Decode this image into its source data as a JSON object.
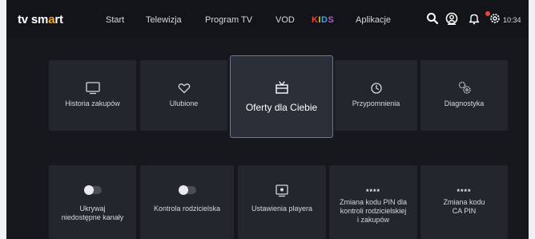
{
  "header": {
    "logo_prefix": "tv sm",
    "logo_mark": "a",
    "logo_suffix": "rt",
    "nav": {
      "start": "Start",
      "telewizja": "Telewizja",
      "program": "Program TV",
      "vod": "VOD",
      "kids_letters": [
        "K",
        "I",
        "D",
        "S"
      ],
      "aplikacje": "Aplikacje"
    },
    "icons": [
      "search-icon",
      "profile-icon",
      "notifications-icon",
      "settings-icon"
    ],
    "time": "10:34"
  },
  "tiles_row1": [
    {
      "label": "Historia zakupów",
      "icon": "tv-icon"
    },
    {
      "label": "Ulubione",
      "icon": "heart-icon"
    },
    {
      "label": "Oferty dla Ciebie",
      "icon": "gift-icon",
      "focused": true
    },
    {
      "label": "Przypomnienia",
      "icon": "clock-icon"
    },
    {
      "label": "Diagnostyka",
      "icon": "gears-icon"
    }
  ],
  "tiles_row2": [
    {
      "label_lines": [
        "Ukrywaj",
        "niedostępne kanały"
      ],
      "icon": "toggle-icon"
    },
    {
      "label_lines": [
        "Kontrola rodzicielska"
      ],
      "icon": "toggle-icon"
    },
    {
      "label_lines": [
        "Ustawienia playera"
      ],
      "icon": "player-icon"
    },
    {
      "pin": "****",
      "label_lines": [
        "Zmiana kodu PIN dla",
        "kontroli rodzicielskiej",
        "i zakupów"
      ],
      "icon": "pin-icon"
    },
    {
      "pin": "****",
      "label_lines": [
        "Zmiana kodu",
        "CA PIN"
      ],
      "icon": "pin-icon"
    }
  ],
  "colors": {
    "background": "#16181d",
    "tile": "#23262d",
    "focus_border": "#3f7fdd",
    "notification_badge": "#e8453c"
  }
}
